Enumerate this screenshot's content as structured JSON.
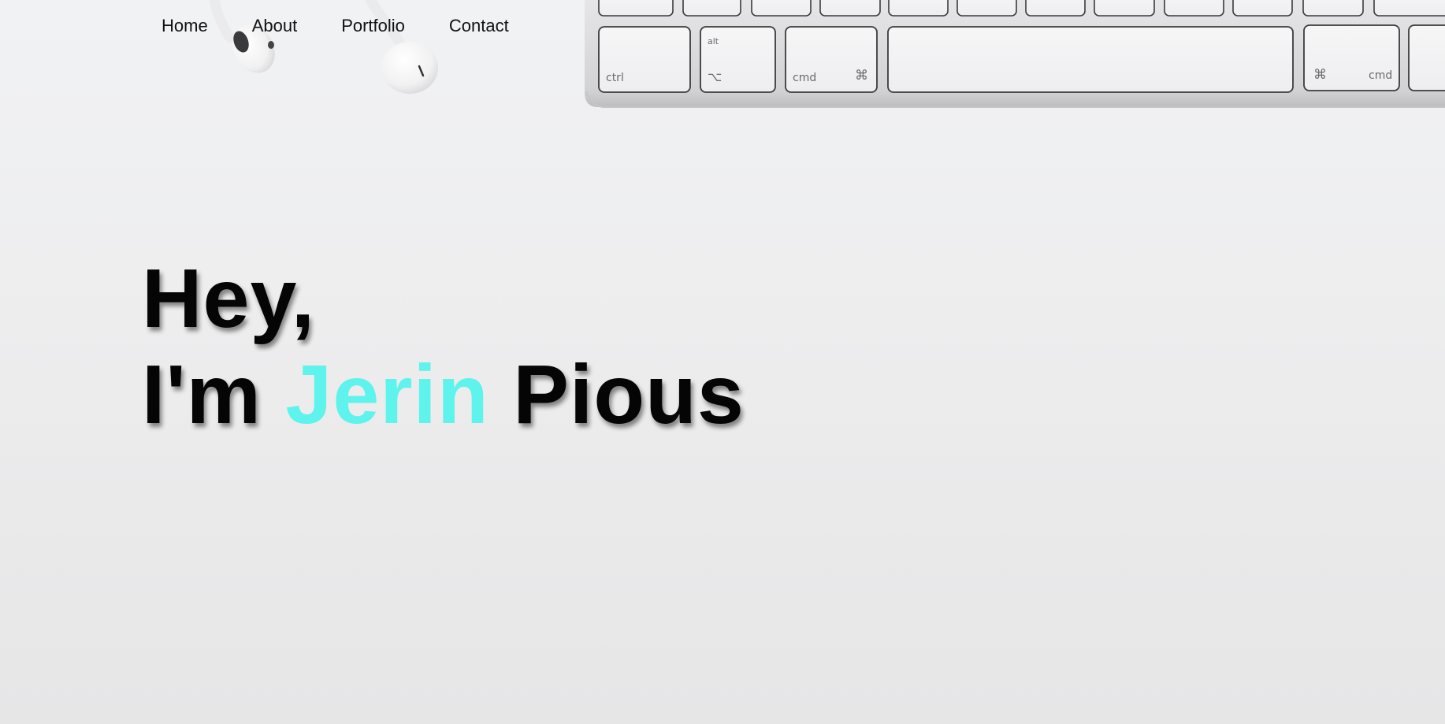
{
  "nav": {
    "items": [
      {
        "label": "Home"
      },
      {
        "label": "About"
      },
      {
        "label": "Portfolio"
      },
      {
        "label": "Contact"
      }
    ]
  },
  "hero": {
    "greeting": "Hey,",
    "intro_prefix": "I'm",
    "first_name": "Jerin",
    "last_name": "Pious",
    "accent_color": "#5ef3ec"
  },
  "decor": {
    "keyboard_keys": {
      "ctrl": "ctrl",
      "alt": "alt",
      "option_symbol": "⌥",
      "cmd_left": "cmd",
      "cmd_symbol_left": "⌘",
      "cmd_symbol_right": "⌘",
      "cmd_right": "cmd"
    }
  }
}
